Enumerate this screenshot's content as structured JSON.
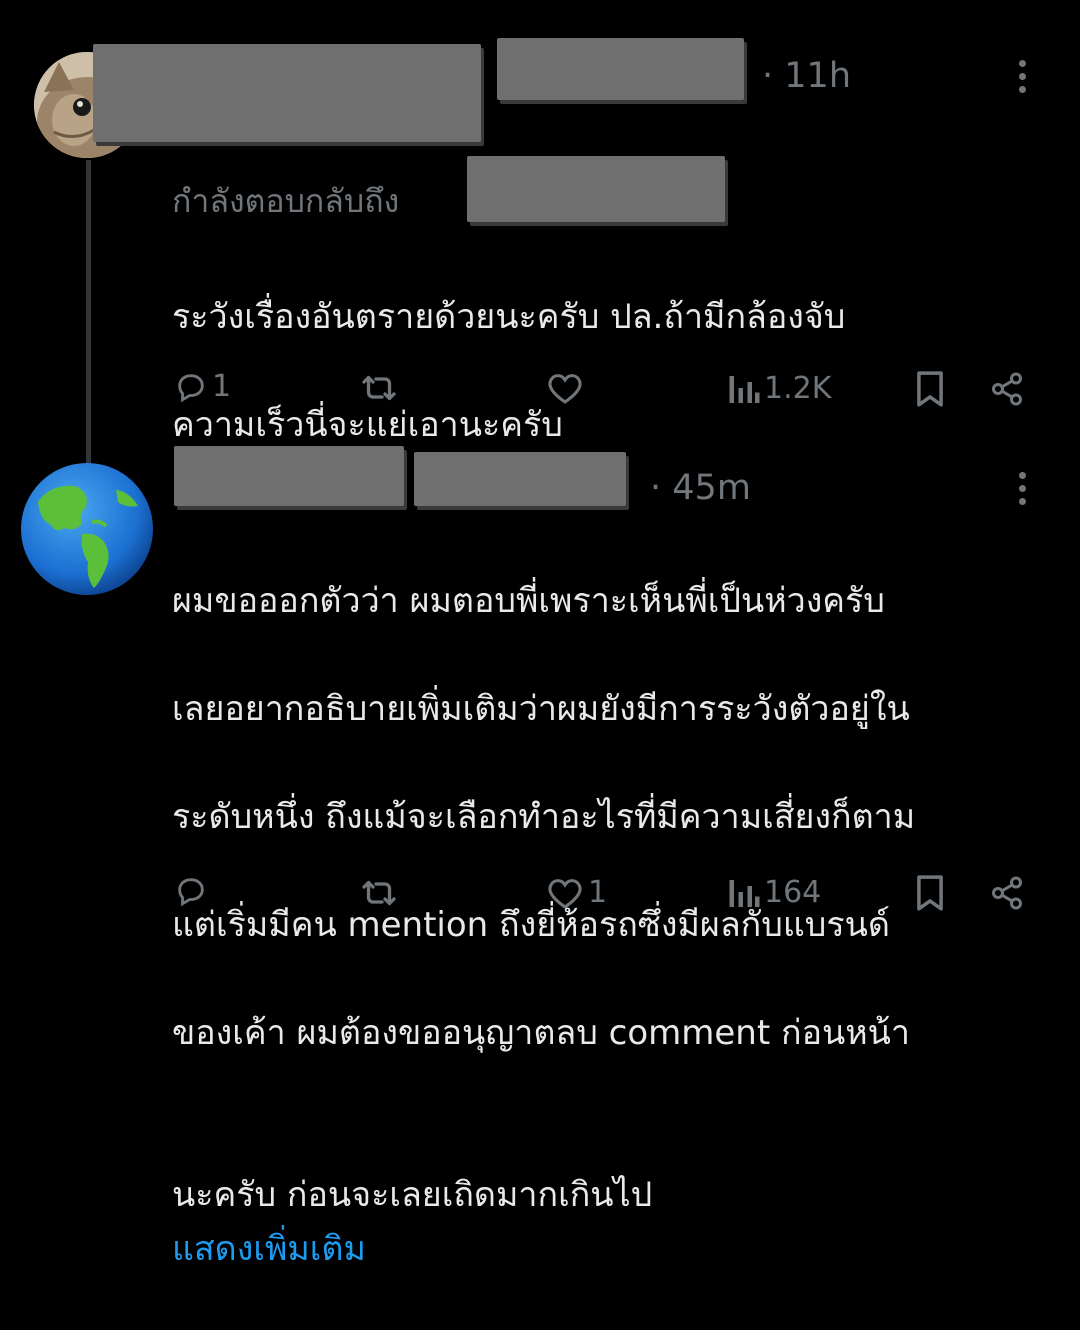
{
  "tweets": [
    {
      "time_sep": "·",
      "time": "11h",
      "replying_to_label": "กำลังตอบกลับถึง",
      "body_lines": [
        "ระวังเรื่องอันตรายด้วยนะครับ ปล.ถ้ามีกล้องจับ",
        "ความเร็วนี่จะแย่เอานะครับ"
      ],
      "actions": {
        "reply_count": "1",
        "retweet_count": "",
        "like_count": "",
        "views_count": "1.2K"
      }
    },
    {
      "time_sep": "·",
      "time": "45m",
      "body_lines": [
        "ผมขอออกตัวว่า ผมตอบพี่เพราะเห็นพี่เป็นห่วงครับ",
        "เลยอยากอธิบายเพิ่มเติมว่าผมยังมีการระวังตัวอยู่ใน",
        "ระดับหนึ่ง ถึงแม้จะเลือกทำอะไรที่มีความเสี่ยงก็ตาม",
        "แต่เริ่มมีคน mention ถึงยี่ห้อรถซึ่งมีผลกับแบรนด์",
        "ของเค้า ผมต้องขออนุญาตลบ comment ก่อนหน้า"
      ],
      "last_line": "นะครับ ก่อนจะเลยเถิดมากเกินไป",
      "show_more": "แสดงเพิ่มเติม",
      "actions": {
        "reply_count": "",
        "retweet_count": "",
        "like_count": "1",
        "views_count": "164"
      }
    }
  ],
  "icons": {
    "reply": "reply-icon",
    "retweet": "retweet-icon",
    "like": "heart-icon",
    "views": "views-icon",
    "bookmark": "bookmark-icon",
    "share": "share-icon",
    "more": "more-icon"
  },
  "colors": {
    "background": "#000000",
    "text": "#e7e9ea",
    "muted": "#71767b",
    "link": "#1d9bf0",
    "redaction": "#6f6f6f"
  }
}
